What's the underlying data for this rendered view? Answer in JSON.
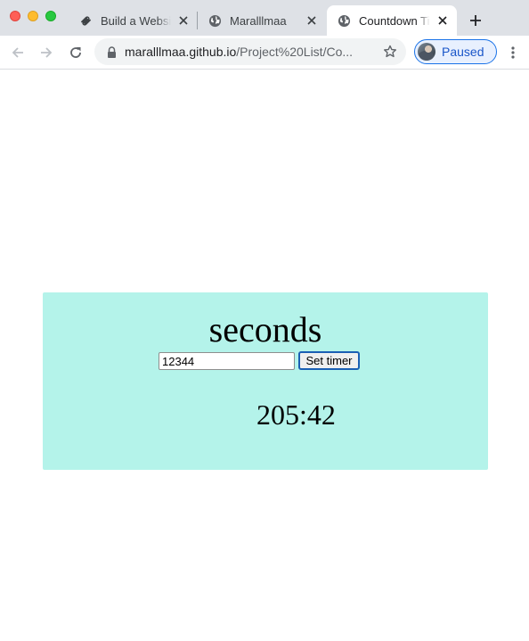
{
  "browser": {
    "tabs": [
      {
        "title": "Build a Website",
        "icon": "squarespace-icon"
      },
      {
        "title": "Maralllmaa",
        "icon": "globe-icon"
      },
      {
        "title": "Countdown Timer",
        "icon": "globe-icon",
        "active": true
      }
    ],
    "address_host": "maralllmaa.github.io",
    "address_path": "/Project%20List/Co...",
    "profile_label": "Paused"
  },
  "page": {
    "unit_heading": "seconds",
    "seconds_input_value": "12344",
    "set_button_label": "Set timer",
    "time_remaining": "205:42",
    "card_color": "#b4f3ea"
  }
}
